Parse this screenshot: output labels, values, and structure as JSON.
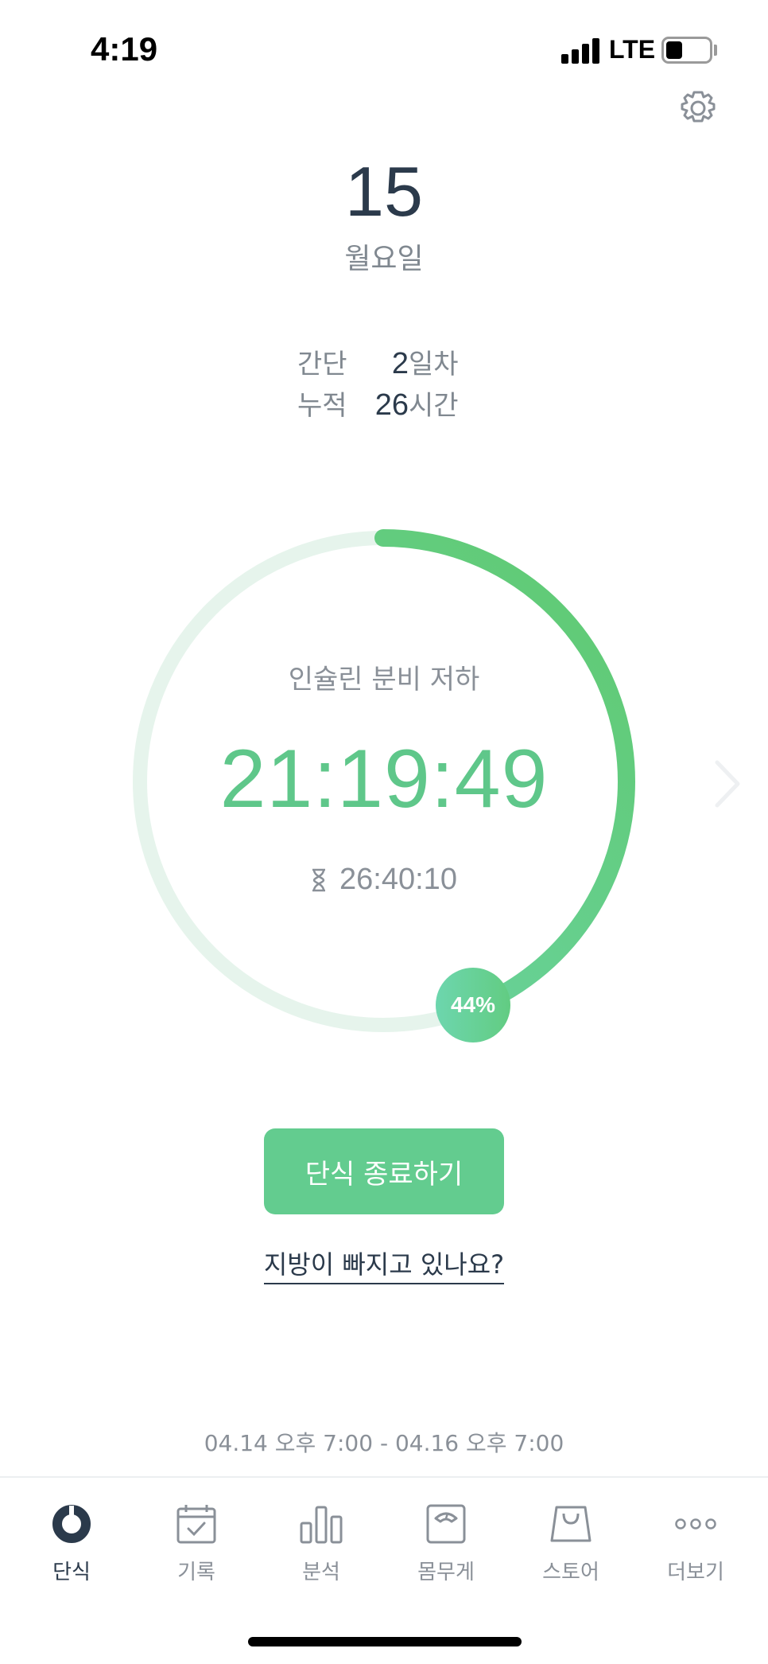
{
  "status_bar": {
    "time": "4:19",
    "network": "LTE"
  },
  "summary": {
    "date_number": "15",
    "weekday": "월요일",
    "stats": [
      {
        "label": "간단",
        "value": "2",
        "unit": "일차"
      },
      {
        "label": "누적",
        "value": "26",
        "unit": "시간"
      }
    ]
  },
  "timer": {
    "phase": "인슐린 분비 저하",
    "elapsed": "21:19:49",
    "remaining": "26:40:10",
    "progress_percent": 44,
    "progress_label": "44%"
  },
  "actions": {
    "end_button": "단식 종료하기",
    "fat_link": "지방이 빠지고 있나요?"
  },
  "fasting_range": "04.14 오후 7:00 - 04.16 오후 7:00",
  "tabs": [
    {
      "label": "단식",
      "icon": "fasting-ring-icon",
      "active": true
    },
    {
      "label": "기록",
      "icon": "calendar-check-icon",
      "active": false
    },
    {
      "label": "분석",
      "icon": "bar-chart-icon",
      "active": false
    },
    {
      "label": "몸무게",
      "icon": "scale-icon",
      "active": false
    },
    {
      "label": "스토어",
      "icon": "shopping-bag-icon",
      "active": false
    },
    {
      "label": "더보기",
      "icon": "more-dots-icon",
      "active": false
    }
  ],
  "colors": {
    "accent_green": "#63cc8f",
    "ring_track": "#e6f4ec",
    "ring_gradient_start": "#6dd6ae",
    "ring_gradient_end": "#5fc96f",
    "text_dark": "#2b3a4b",
    "text_gray": "#8a9098"
  }
}
